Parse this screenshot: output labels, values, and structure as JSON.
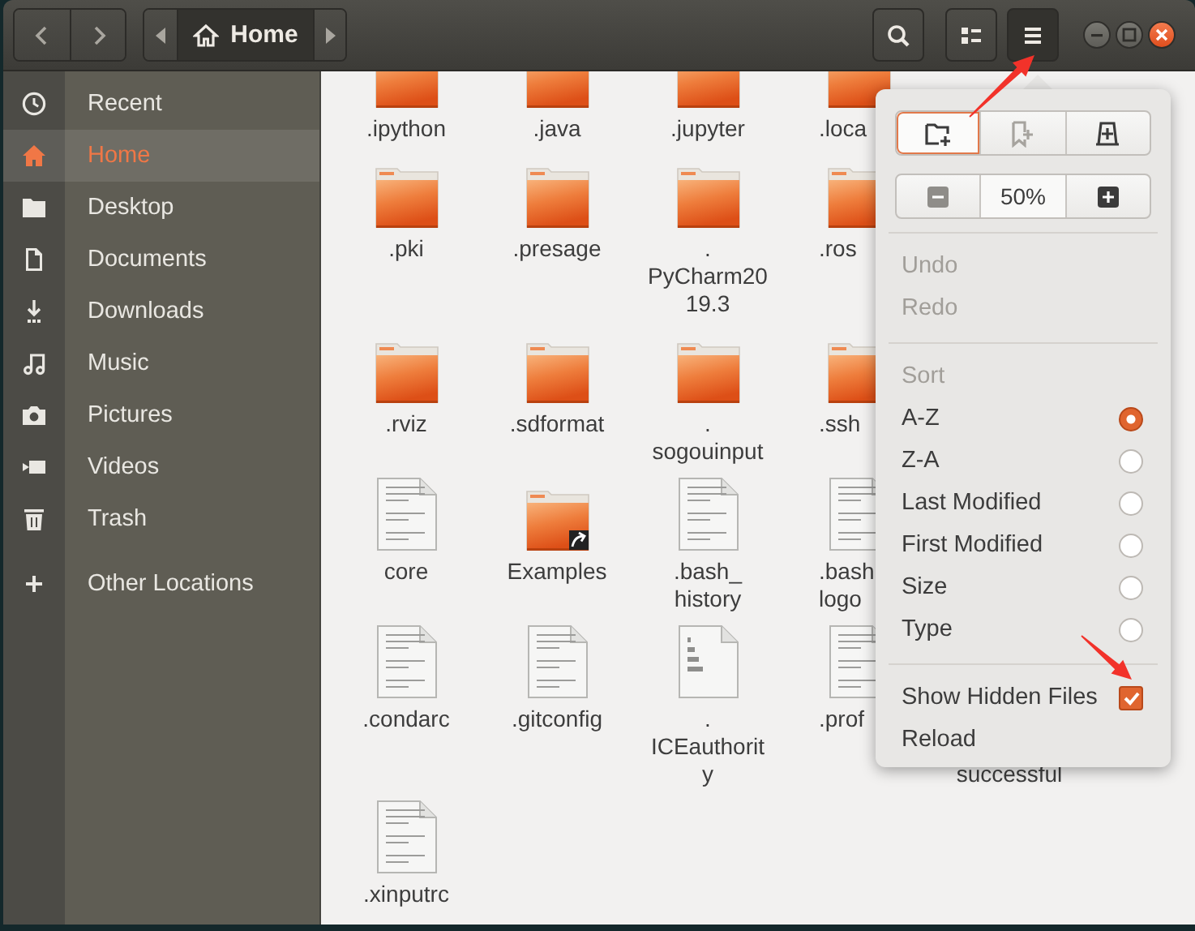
{
  "toolbar": {
    "nav_buttons": [
      {
        "kind": "back"
      },
      {
        "kind": "forward"
      }
    ],
    "path": {
      "label": "Home"
    },
    "buttons": [
      {
        "kind": "search",
        "pressed": false
      },
      {
        "kind": "view",
        "pressed": false
      },
      {
        "kind": "menu",
        "pressed": true
      }
    ]
  },
  "window_controls": [
    {
      "kind": "minimize"
    },
    {
      "kind": "maximize"
    },
    {
      "kind": "close"
    }
  ],
  "sidebar": {
    "items": [
      {
        "kind": "recent",
        "label": "Recent",
        "selected": false
      },
      {
        "kind": "home",
        "label": "Home",
        "selected": true
      },
      {
        "kind": "desktop",
        "label": "Desktop",
        "selected": false
      },
      {
        "kind": "documents",
        "label": "Documents",
        "selected": false
      },
      {
        "kind": "downloads",
        "label": "Downloads",
        "selected": false
      },
      {
        "kind": "music",
        "label": "Music",
        "selected": false
      },
      {
        "kind": "pictures",
        "label": "Pictures",
        "selected": false
      },
      {
        "kind": "videos",
        "label": "Videos",
        "selected": false
      },
      {
        "kind": "trash",
        "label": "Trash",
        "selected": false
      },
      {
        "kind": "other",
        "label": "Other Locations",
        "selected": false
      }
    ]
  },
  "files": {
    "rows": [
      [
        {
          "kind": "folder",
          "name": ".ipython"
        },
        {
          "kind": "folder",
          "name": ".java"
        },
        {
          "kind": "folder",
          "name": ".jupyter"
        },
        {
          "kind": "folder",
          "name": ".loca"
        }
      ],
      [
        {
          "kind": "folder",
          "name": ".pki"
        },
        {
          "kind": "folder",
          "name": ".presage"
        },
        {
          "kind": "folder",
          "name": ".\nPyCharm20\n19.3"
        },
        {
          "kind": "folder",
          "name": ".ros"
        }
      ],
      [
        {
          "kind": "folder",
          "name": ".rviz"
        },
        {
          "kind": "folder",
          "name": ".sdformat"
        },
        {
          "kind": "folder",
          "name": ".\nsogouinput"
        },
        {
          "kind": "folder",
          "name": ".ssh"
        }
      ],
      [
        {
          "kind": "text",
          "name": "core"
        },
        {
          "kind": "link-folder",
          "name": "Examples"
        },
        {
          "kind": "text",
          "name": ".bash_\nhistory"
        },
        {
          "kind": "text",
          "name": ".bash\nlogo"
        }
      ],
      [
        {
          "kind": "text",
          "name": ".condarc"
        },
        {
          "kind": "text",
          "name": ".gitconfig"
        },
        {
          "kind": "binary",
          "name": ".\nICEauthorit\ny"
        },
        {
          "kind": "text",
          "name": ".prof"
        },
        {
          "kind": "covered",
          "name": "successful"
        }
      ],
      [
        {
          "kind": "text",
          "name": ".xinputrc"
        }
      ]
    ]
  },
  "menu": {
    "icon_buttons": [
      {
        "kind": "new-folder",
        "focused": true,
        "disabled": false
      },
      {
        "kind": "bookmark",
        "focused": false,
        "disabled": true
      },
      {
        "kind": "new-tab",
        "focused": false,
        "disabled": false
      }
    ],
    "zoom": {
      "value": "50%",
      "out_disabled": true
    },
    "items": [
      {
        "kind": "action",
        "label": "Undo",
        "disabled": true
      },
      {
        "kind": "action",
        "label": "Redo",
        "disabled": true
      },
      {
        "kind": "separator"
      },
      {
        "kind": "header",
        "label": "Sort"
      },
      {
        "kind": "radio",
        "label": "A-Z",
        "selected": true
      },
      {
        "kind": "radio",
        "label": "Z-A",
        "selected": false
      },
      {
        "kind": "radio",
        "label": "Last Modified",
        "selected": false
      },
      {
        "kind": "radio",
        "label": "First Modified",
        "selected": false
      },
      {
        "kind": "radio",
        "label": "Size",
        "selected": false
      },
      {
        "kind": "radio",
        "label": "Type",
        "selected": false
      },
      {
        "kind": "separator"
      },
      {
        "kind": "check",
        "label": "Show Hidden Files",
        "checked": true
      },
      {
        "kind": "action",
        "label": "Reload",
        "disabled": false
      }
    ]
  }
}
